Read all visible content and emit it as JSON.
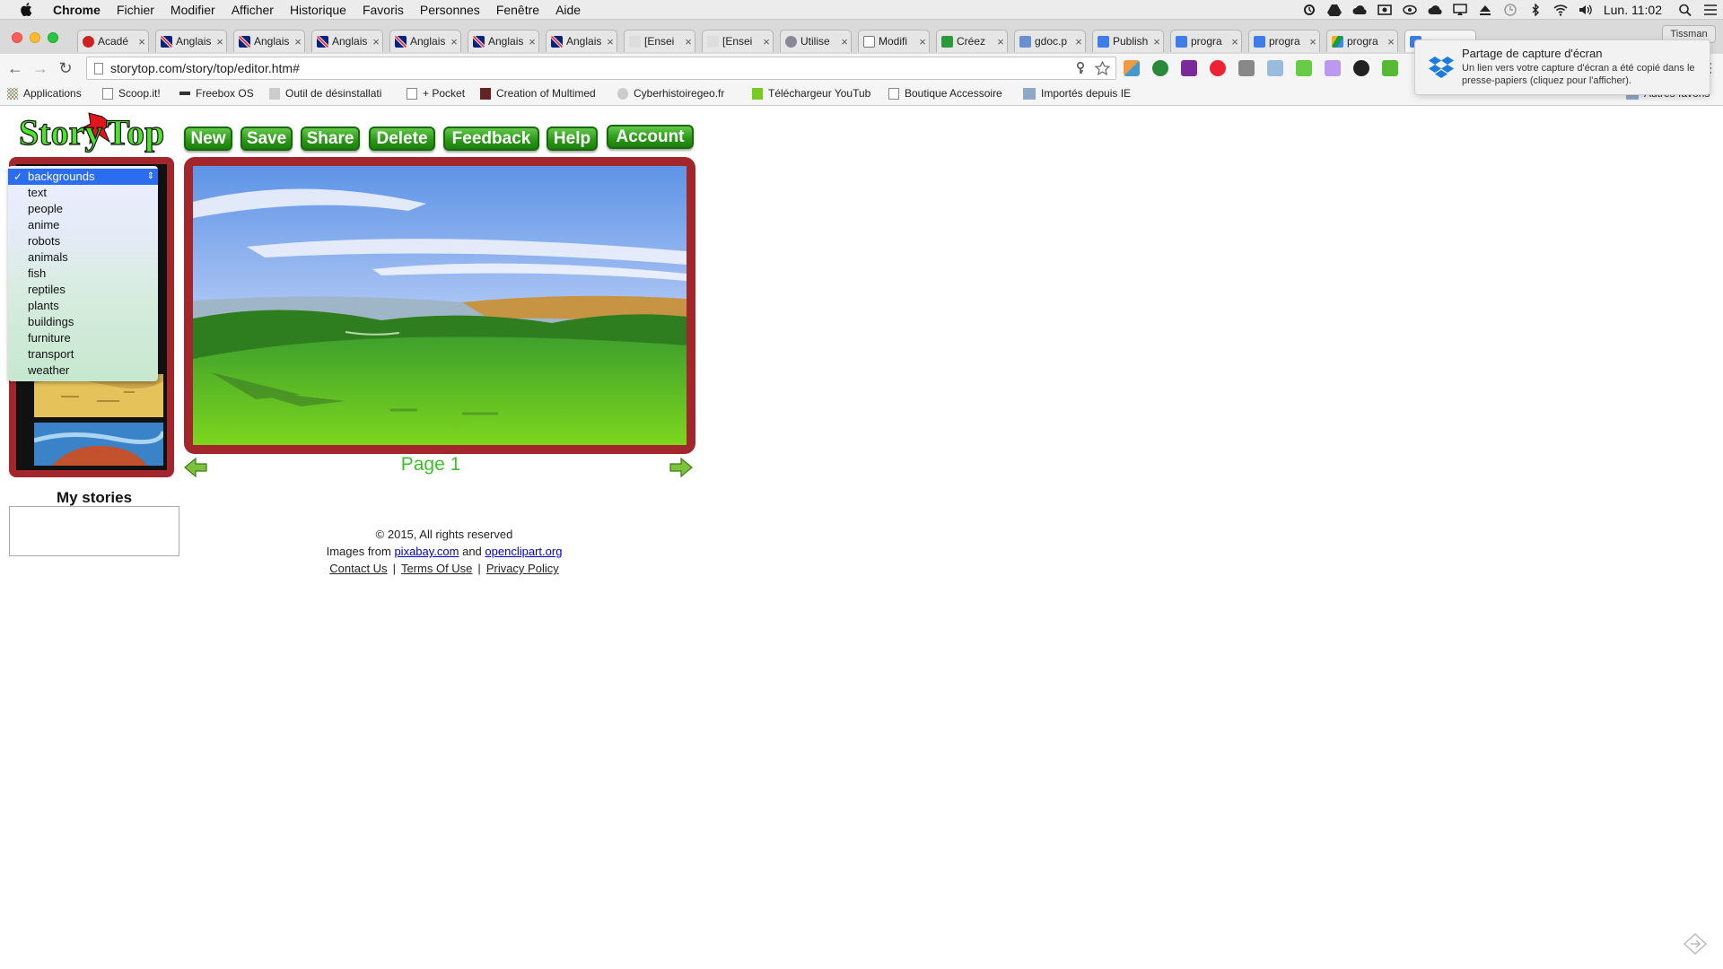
{
  "menubar": {
    "app": "Chrome",
    "items": [
      "Fichier",
      "Modifier",
      "Afficher",
      "Historique",
      "Favoris",
      "Personnes",
      "Fenêtre",
      "Aide"
    ],
    "clock": "Lun. 11:02"
  },
  "tabs": [
    {
      "label": "Acadé"
    },
    {
      "label": "Anglais"
    },
    {
      "label": "Anglais"
    },
    {
      "label": "Anglais"
    },
    {
      "label": "Anglais"
    },
    {
      "label": "Anglais"
    },
    {
      "label": "Anglais"
    },
    {
      "label": "[Ensei"
    },
    {
      "label": "[Ensei"
    },
    {
      "label": "Utilise"
    },
    {
      "label": "Modifi"
    },
    {
      "label": "Créez"
    },
    {
      "label": "gdoc.p"
    },
    {
      "label": "Publish"
    },
    {
      "label": "progra"
    },
    {
      "label": "progra"
    },
    {
      "label": "progra"
    }
  ],
  "profile": "Tissman",
  "url": "storytop.com/story/top/editor.htm#",
  "bookmarks": [
    "Applications",
    "Scoop.it!",
    "Freebox OS",
    "Outil de désinstallati",
    "+ Pocket",
    "Creation of Multimed",
    "Cyberhistoiregeo.fr",
    "Téléchargeur YouTub",
    "Boutique Accessoire",
    "Importés depuis IE",
    "Autres favoris"
  ],
  "notification": {
    "title": "Partage de capture d'écran",
    "body": "Un lien vers votre capture d'écran a été copié dans le presse-papiers (cliquez pour l'afficher)."
  },
  "app": {
    "buttons": [
      "New",
      "Save",
      "Share",
      "Delete",
      "Feedback",
      "Help",
      "Account"
    ],
    "dropdown": {
      "selected": "backgrounds",
      "options": [
        "backgrounds",
        "text",
        "people",
        "anime",
        "robots",
        "animals",
        "fish",
        "reptiles",
        "plants",
        "buildings",
        "furniture",
        "transport",
        "weather"
      ]
    },
    "page_label": "Page 1",
    "mystories_title": "My stories"
  },
  "footer": {
    "copyright": "© 2015, All rights reserved",
    "images_prefix": "Images from",
    "link1": "pixabay.com",
    "and": "and",
    "link2": "openclipart.org",
    "contact": "Contact Us",
    "terms": "Terms Of Use",
    "privacy": "Privacy Policy"
  },
  "colors": {
    "frame": "#a3262d",
    "button_green": "#2d9a19",
    "page_label": "#3bbf2a",
    "dropdown_selected": "#2a6df0"
  }
}
